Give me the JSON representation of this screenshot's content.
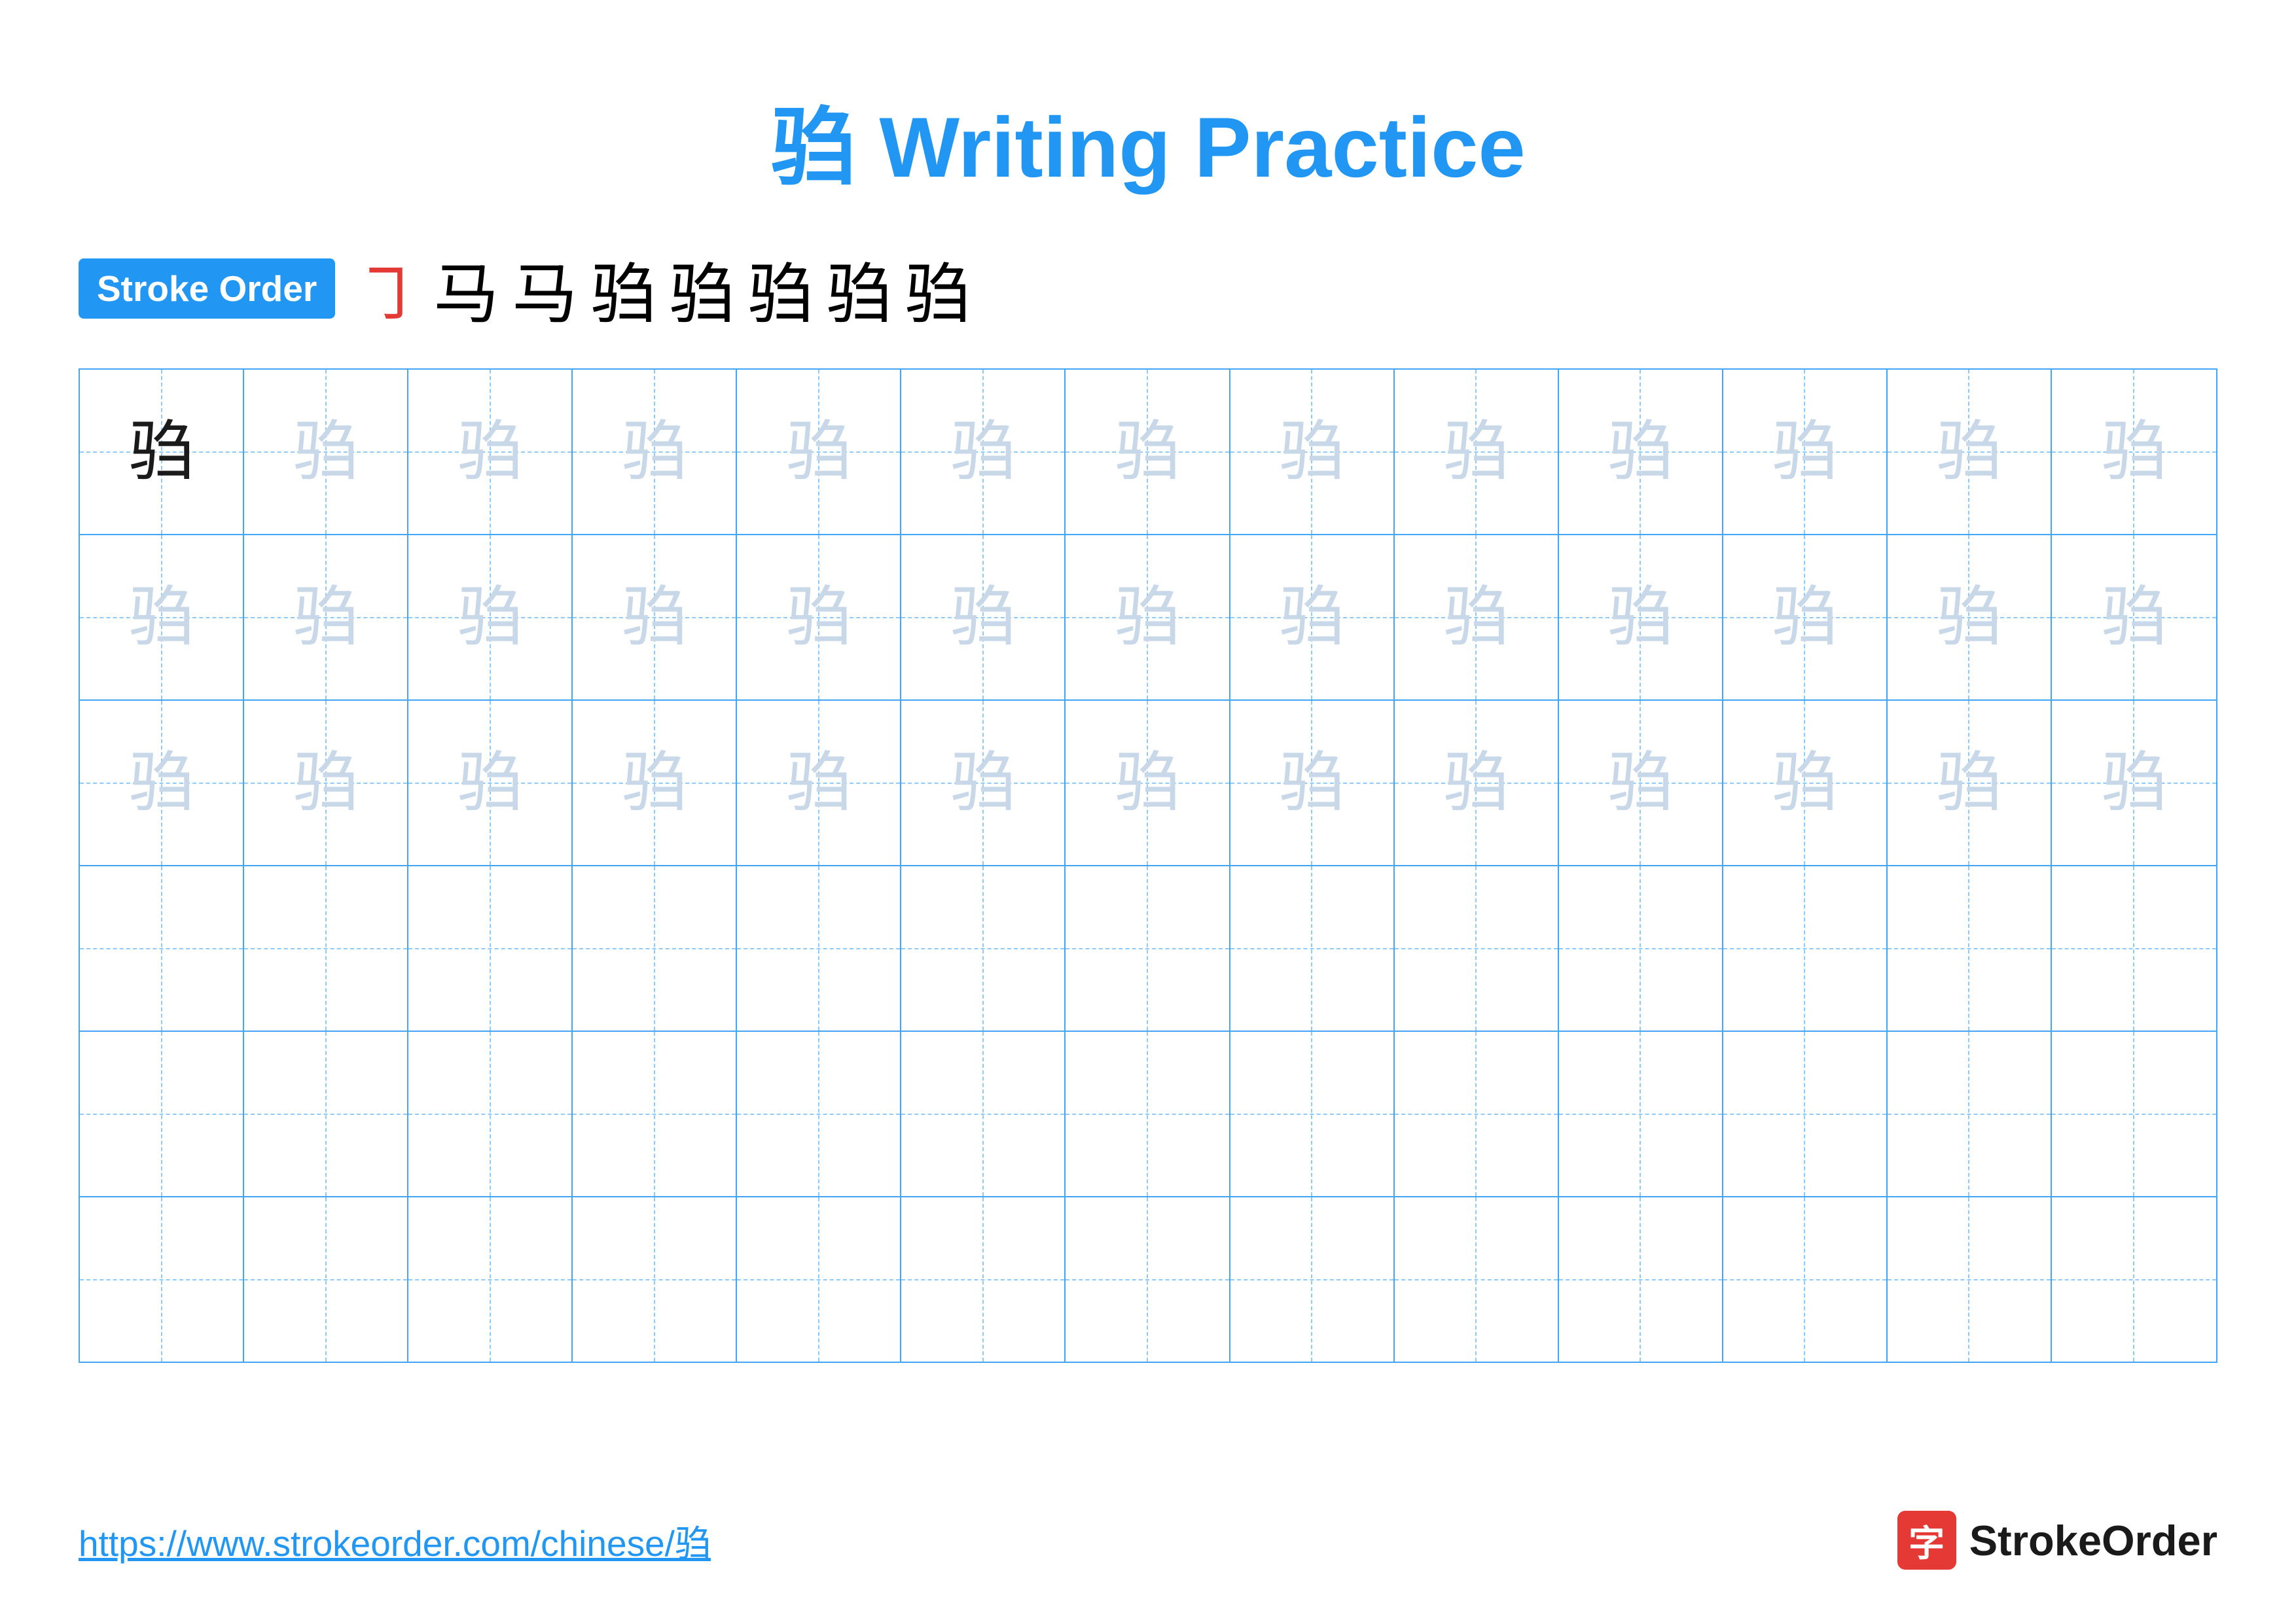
{
  "title": {
    "char": "驺",
    "label": "Writing Practice",
    "full": "驺 Writing Practice"
  },
  "stroke_order": {
    "badge_label": "Stroke Order",
    "strokes": [
      "㇆",
      "马",
      "马",
      "马丨",
      "马丨",
      "驺",
      "驺",
      "驺"
    ]
  },
  "grid": {
    "rows": 6,
    "cols": 13,
    "char": "驺",
    "row_types": [
      "dark_first_rest_light",
      "all_light",
      "all_light",
      "empty",
      "empty",
      "empty"
    ]
  },
  "footer": {
    "url": "https://www.strokeorder.com/chinese/驺",
    "logo_icon": "字",
    "logo_name": "StrokeOrder"
  },
  "colors": {
    "blue": "#2196F3",
    "red": "#e53935",
    "grid_blue": "#42A5F5",
    "light_char": "#c8d8e8",
    "dashed": "#90CAF9"
  }
}
